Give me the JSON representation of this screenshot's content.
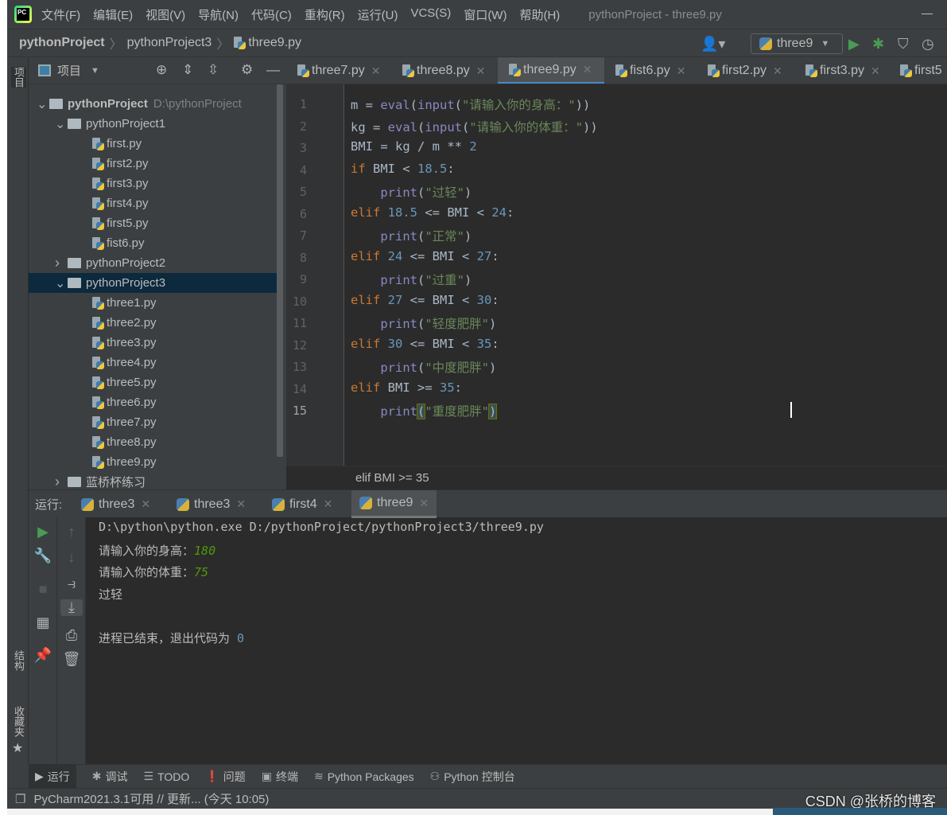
{
  "menu": {
    "items": [
      "文件(F)",
      "编辑(E)",
      "视图(V)",
      "导航(N)",
      "代码(C)",
      "重构(R)",
      "运行(U)",
      "VCS(S)",
      "窗口(W)",
      "帮助(H)"
    ],
    "window_title": "pythonProject - three9.py"
  },
  "navbar": {
    "crumbs": [
      "pythonProject",
      "pythonProject3",
      "three9.py"
    ],
    "run_config": "three9"
  },
  "side_tabs": {
    "project": "项目",
    "structure": "结构",
    "favorites": "收藏夹"
  },
  "project": {
    "title": "项目",
    "tree": [
      {
        "label": "pythonProject",
        "path": "D:\\pythonProject",
        "level": 0,
        "type": "folder",
        "expanded": true,
        "bold": true
      },
      {
        "label": "pythonProject1",
        "level": 1,
        "type": "folder",
        "expanded": true
      },
      {
        "label": "first.py",
        "level": 2,
        "type": "file"
      },
      {
        "label": "first2.py",
        "level": 2,
        "type": "file"
      },
      {
        "label": "first3.py",
        "level": 2,
        "type": "file"
      },
      {
        "label": "first4.py",
        "level": 2,
        "type": "file"
      },
      {
        "label": "first5.py",
        "level": 2,
        "type": "file"
      },
      {
        "label": "fist6.py",
        "level": 2,
        "type": "file"
      },
      {
        "label": "pythonProject2",
        "level": 1,
        "type": "folder",
        "expanded": false
      },
      {
        "label": "pythonProject3",
        "level": 1,
        "type": "folder",
        "expanded": true,
        "selected": true
      },
      {
        "label": "three1.py",
        "level": 2,
        "type": "file"
      },
      {
        "label": "three2.py",
        "level": 2,
        "type": "file"
      },
      {
        "label": "three3.py",
        "level": 2,
        "type": "file"
      },
      {
        "label": "three4.py",
        "level": 2,
        "type": "file"
      },
      {
        "label": "three5.py",
        "level": 2,
        "type": "file"
      },
      {
        "label": "three6.py",
        "level": 2,
        "type": "file"
      },
      {
        "label": "three7.py",
        "level": 2,
        "type": "file"
      },
      {
        "label": "three8.py",
        "level": 2,
        "type": "file"
      },
      {
        "label": "three9.py",
        "level": 2,
        "type": "file"
      },
      {
        "label": "蓝桥杯练习",
        "level": 1,
        "type": "folder",
        "expanded": false
      }
    ]
  },
  "editor": {
    "tabs": [
      {
        "label": "three7.py"
      },
      {
        "label": "three8.py"
      },
      {
        "label": "three9.py",
        "active": true
      },
      {
        "label": "fist6.py"
      },
      {
        "label": "first2.py"
      },
      {
        "label": "first3.py"
      },
      {
        "label": "first5"
      }
    ],
    "current_line": 15,
    "lines": [
      [
        [
          "m = ",
          ""
        ],
        [
          "eval",
          "bi"
        ],
        [
          "(",
          ""
        ],
        [
          "input",
          "bi"
        ],
        [
          "(",
          ""
        ],
        [
          "\"请输入你的身高：\"",
          "str"
        ],
        [
          "))",
          ""
        ]
      ],
      [
        [
          "kg = ",
          ""
        ],
        [
          "eval",
          "bi"
        ],
        [
          "(",
          ""
        ],
        [
          "input",
          "bi"
        ],
        [
          "(",
          ""
        ],
        [
          "\"请输入你的体重：\"",
          "str"
        ],
        [
          "))",
          ""
        ]
      ],
      [
        [
          "BMI = kg / m ** ",
          ""
        ],
        [
          "2",
          "num"
        ]
      ],
      [
        [
          "if",
          "kw"
        ],
        [
          " BMI < ",
          ""
        ],
        [
          "18.5",
          "num"
        ],
        [
          ":",
          ""
        ]
      ],
      [
        [
          "    ",
          ""
        ],
        [
          "print",
          "bi"
        ],
        [
          "(",
          ""
        ],
        [
          "\"过轻\"",
          "str"
        ],
        [
          ")",
          ""
        ]
      ],
      [
        [
          "elif",
          "kw"
        ],
        [
          " ",
          ""
        ],
        [
          "18.5",
          "num"
        ],
        [
          " <= BMI < ",
          ""
        ],
        [
          "24",
          "num"
        ],
        [
          ":",
          ""
        ]
      ],
      [
        [
          "    ",
          ""
        ],
        [
          "print",
          "bi"
        ],
        [
          "(",
          ""
        ],
        [
          "\"正常\"",
          "str"
        ],
        [
          ")",
          ""
        ]
      ],
      [
        [
          "elif",
          "kw"
        ],
        [
          " ",
          ""
        ],
        [
          "24",
          "num"
        ],
        [
          " <= BMI < ",
          ""
        ],
        [
          "27",
          "num"
        ],
        [
          ":",
          ""
        ]
      ],
      [
        [
          "    ",
          ""
        ],
        [
          "print",
          "bi"
        ],
        [
          "(",
          ""
        ],
        [
          "\"过重\"",
          "str"
        ],
        [
          ")",
          ""
        ]
      ],
      [
        [
          "elif",
          "kw"
        ],
        [
          " ",
          ""
        ],
        [
          "27",
          "num"
        ],
        [
          " <= BMI < ",
          ""
        ],
        [
          "30",
          "num"
        ],
        [
          ":",
          ""
        ]
      ],
      [
        [
          "    ",
          ""
        ],
        [
          "print",
          "bi"
        ],
        [
          "(",
          ""
        ],
        [
          "\"轻度肥胖\"",
          "str"
        ],
        [
          ")",
          ""
        ]
      ],
      [
        [
          "elif",
          "kw"
        ],
        [
          " ",
          ""
        ],
        [
          "30",
          "num"
        ],
        [
          " <= BMI < ",
          ""
        ],
        [
          "35",
          "num"
        ],
        [
          ":",
          ""
        ]
      ],
      [
        [
          "    ",
          ""
        ],
        [
          "print",
          "bi"
        ],
        [
          "(",
          ""
        ],
        [
          "\"中度肥胖\"",
          "str"
        ],
        [
          ")",
          ""
        ]
      ],
      [
        [
          "elif",
          "kw"
        ],
        [
          " BMI >= ",
          ""
        ],
        [
          "35",
          "num"
        ],
        [
          ":",
          ""
        ]
      ],
      [
        [
          "    ",
          ""
        ],
        [
          "print",
          "bi"
        ],
        [
          "(",
          "br"
        ],
        [
          "\"重度肥胖\"",
          "str"
        ],
        [
          ")",
          "br"
        ]
      ]
    ],
    "breadcrumb": "elif BMI >= 35"
  },
  "run": {
    "label": "运行:",
    "tabs": [
      {
        "label": "three3"
      },
      {
        "label": "three3"
      },
      {
        "label": "first4"
      },
      {
        "label": "three9",
        "active": true
      }
    ],
    "console": [
      {
        "text": "D:\\python\\python.exe D:/pythonProject/pythonProject3/three9.py"
      },
      {
        "text": "请输入你的身高：",
        "input": "180"
      },
      {
        "text": "请输入你的体重：",
        "input": "75"
      },
      {
        "text": "过轻"
      },
      {
        "text": ""
      },
      {
        "text": "进程已结束，退出代码为 ",
        "code": "0"
      }
    ]
  },
  "bottom_tools": [
    {
      "label": "运行",
      "icon": "run-icon",
      "active": true
    },
    {
      "label": "调试",
      "icon": "bug-icon"
    },
    {
      "label": "TODO",
      "icon": "list-icon"
    },
    {
      "label": "问题",
      "icon": "problems-icon"
    },
    {
      "label": "终端",
      "icon": "terminal-icon"
    },
    {
      "label": "Python Packages",
      "icon": "packages-icon"
    },
    {
      "label": "Python 控制台",
      "icon": "python-console-icon"
    }
  ],
  "status": {
    "text": "PyCharm2021.3.1可用 // 更新... (今天 10:05)"
  },
  "watermark": "CSDN @张桥的博客",
  "colors": {
    "keyword": "#cc7832",
    "builtin": "#8888c6",
    "string": "#6a8759",
    "number": "#6897bb",
    "text": "#a9b7c6",
    "editor_bg": "#2b2b2b",
    "panel_bg": "#3c3f41",
    "selection": "#0d293e",
    "run_green": "#499c54"
  }
}
